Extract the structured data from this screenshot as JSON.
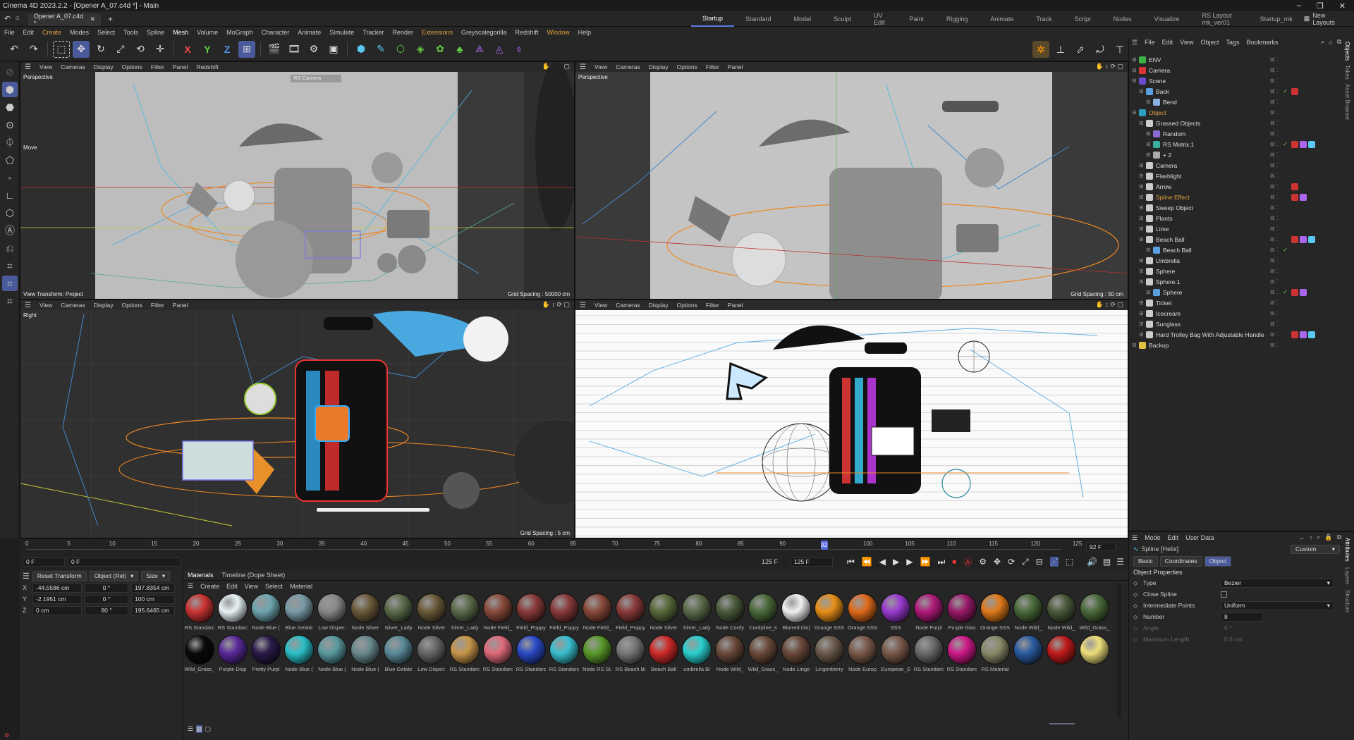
{
  "window": {
    "title": "Cinema 4D 2023.2.2 - [Opener A_07.c4d *] - Main",
    "doc_tab": "Opener A_07.c4d *",
    "new_layouts": "New Layouts"
  },
  "layouts": [
    "Startup",
    "Standard",
    "Model",
    "Sculpt",
    "UV Edit",
    "Paint",
    "Rigging",
    "Animate",
    "Track",
    "Script",
    "Nodes",
    "Visualize",
    "RS Layout mk_ver01",
    "Startup_mk"
  ],
  "menu": [
    "File",
    "Edit",
    "Create",
    "Modes",
    "Select",
    "Tools",
    "Spline",
    "Mesh",
    "Volume",
    "MoGraph",
    "Character",
    "Animate",
    "Simulate",
    "Tracker",
    "Render",
    "Extensions",
    "Greyscalegorilla",
    "Redshift",
    "Window",
    "Help"
  ],
  "viewports": [
    {
      "menu": [
        "View",
        "Cameras",
        "Display",
        "Options",
        "Filter",
        "Panel",
        "Redshift"
      ],
      "name": "Perspective",
      "grid": "Grid Spacing : 50000 cm",
      "transform": "View Transform: Project",
      "camera_tag": "RS Camera",
      "move_label": "Move"
    },
    {
      "menu": [
        "View",
        "Cameras",
        "Display",
        "Options",
        "Filter",
        "Panel"
      ],
      "name": "Perspective",
      "grid": "Grid Spacing : 50 cm"
    },
    {
      "menu": [
        "View",
        "Cameras",
        "Display",
        "Options",
        "Filter",
        "Panel"
      ],
      "name": "Right",
      "grid": "Grid Spacing : 5 cm"
    },
    {
      "menu": [
        "View",
        "Cameras",
        "Display",
        "Options",
        "Filter",
        "Panel"
      ],
      "name": "",
      "grid": ""
    }
  ],
  "timeline": {
    "ticks": [
      "0",
      "5",
      "10",
      "15",
      "20",
      "25",
      "30",
      "35",
      "40",
      "45",
      "50",
      "55",
      "60",
      "65",
      "70",
      "75",
      "80",
      "85",
      "90",
      "95",
      "100",
      "105",
      "110",
      "115",
      "120",
      "125"
    ],
    "current": "92",
    "frame_field": "92 F",
    "start": "0 F",
    "start2": "0 F",
    "end": "125 F",
    "end2": "125 F"
  },
  "coords": {
    "reset": "Reset Transform",
    "mode": "Object (Rel)",
    "size": "Size",
    "rows": [
      {
        "axis": "X",
        "pos": "-44.5586 cm",
        "rot": "0 °",
        "size": "197.8354 cm"
      },
      {
        "axis": "Y",
        "pos": "-2.1951 cm",
        "rot": "0 °",
        "size": "100 cm"
      },
      {
        "axis": "Z",
        "pos": "0 cm",
        "rot": "90 °",
        "size": "195.6465 cm"
      }
    ]
  },
  "materials_tabs": [
    "Materials",
    "Timeline (Dope Sheet)"
  ],
  "materials_menu": [
    "Create",
    "Edit",
    "View",
    "Select",
    "Material"
  ],
  "materials": [
    {
      "label": "RS Standarc",
      "color": "#c33"
    },
    {
      "label": "RS Standarc",
      "color": "#e8f4f6"
    },
    {
      "label": "Node Blue (",
      "color": "#6fa6b0"
    },
    {
      "label": "Blue Gelatir",
      "color": "#7a9aa8"
    },
    {
      "label": "Low Disper:",
      "color": "#888"
    },
    {
      "label": "Node Silver",
      "color": "#6b5a3a"
    },
    {
      "label": "Silver_Lady",
      "color": "#5a6a4a"
    },
    {
      "label": "Node Silver",
      "color": "#6b5a3a"
    },
    {
      "label": "Silver_Lady",
      "color": "#5a6a4a"
    },
    {
      "label": "Node Field_",
      "color": "#8a4a3a"
    },
    {
      "label": "Field_Poppy",
      "color": "#8a3a3a"
    },
    {
      "label": "Field_Poppy",
      "color": "#8a3a3a"
    },
    {
      "label": "Node Field_",
      "color": "#8a4a3a"
    },
    {
      "label": "Field_Poppy",
      "color": "#8a3a3a"
    },
    {
      "label": "Node Silver",
      "color": "#5a6a3a"
    },
    {
      "label": "Silver_Lady",
      "color": "#5a6a4a"
    },
    {
      "label": "Node Cordy",
      "color": "#4a5a3a"
    },
    {
      "label": "Cordyline_s",
      "color": "#4a6a3a"
    },
    {
      "label": "Blurred Dis|",
      "color": "#f0f0f0"
    },
    {
      "label": "Orange SSS",
      "color": "#e8901a"
    },
    {
      "label": "Orange SSS",
      "color": "#e06a1a"
    },
    {
      "label": "SSS",
      "color": "#9a3ad0"
    },
    {
      "label": "Node Purpl",
      "color": "#b01a7a"
    },
    {
      "label": "Purple Glas",
      "color": "#9a1a6a"
    },
    {
      "label": "Orange SSS",
      "color": "#e07a1a"
    },
    {
      "label": "Node Wild_",
      "color": "#4a6a3a"
    },
    {
      "label": "Node Wild_",
      "color": "#4a5a3a"
    },
    {
      "label": "Wild_Grass_",
      "color": "#4a6a3a"
    },
    {
      "label": "Wild_Grass_",
      "color": "#0a0a0a"
    },
    {
      "label": "Purple Disp",
      "color": "#5a2a9a"
    },
    {
      "label": "Pretty Purpl",
      "color": "#2a1a4a"
    },
    {
      "label": "Node Blue (",
      "color": "#2ac0c8"
    },
    {
      "label": "Node Blue (",
      "color": "#5a9aa0"
    },
    {
      "label": "Node Blue (",
      "color": "#6a8a90"
    },
    {
      "label": "Blue Gelatir",
      "color": "#5a8a98"
    },
    {
      "label": "Low Disper:",
      "color": "#666"
    },
    {
      "label": "RS Standarc",
      "color": "#c8964a"
    },
    {
      "label": "RS Standarc",
      "color": "#e06a7a"
    },
    {
      "label": "RS Standarc",
      "color": "#2a4ac8"
    },
    {
      "label": "RS Standarc",
      "color": "#3ac0d0"
    },
    {
      "label": "Node RS St.",
      "color": "#5a9a2a"
    },
    {
      "label": "RS Beach Bi",
      "color": "#777"
    },
    {
      "label": "Beach Ball",
      "color": "#d02a2a"
    },
    {
      "label": "umbrella Bi",
      "color": "#2ad0d0"
    },
    {
      "label": "Node Wild_",
      "color": "#6a4a3a"
    },
    {
      "label": "Wild_Grass_",
      "color": "#6a4a3a"
    },
    {
      "label": "Node Lingo",
      "color": "#6a4a3a"
    },
    {
      "label": "Lingonberry",
      "color": "#6a5a4a"
    },
    {
      "label": "Node Europ",
      "color": "#7a5a4a"
    },
    {
      "label": "European_S",
      "color": "#7a5a4a"
    },
    {
      "label": "RS Standarc",
      "color": "#6a6a6a"
    },
    {
      "label": "RS Standarc",
      "color": "#d01a8a"
    },
    {
      "label": "RS Material",
      "color": "#8a8a6a"
    },
    {
      "label": "",
      "color": "#2a5aa0"
    },
    {
      "label": "",
      "color": "#c01a1a"
    },
    {
      "label": "",
      "color": "#f0e07a"
    }
  ],
  "objects_menu": [
    "File",
    "Edit",
    "View",
    "Object",
    "Tags",
    "Bookmarks"
  ],
  "objects": [
    {
      "name": "ENV",
      "depth": 0,
      "icon": "#3cb043",
      "color": "#ddd"
    },
    {
      "name": "Camera",
      "depth": 0,
      "icon": "#d33",
      "color": "#ddd"
    },
    {
      "name": "Scene",
      "depth": 0,
      "icon": "#6a4ad0",
      "color": "#ddd"
    },
    {
      "name": "Back",
      "depth": 1,
      "icon": "#5aa0e0",
      "color": "#ddd"
    },
    {
      "name": "Bend",
      "depth": 2,
      "icon": "#8ab0e0",
      "color": "#ddd"
    },
    {
      "name": "Object",
      "depth": 0,
      "icon": "#2aa0c0",
      "color": "#e0a040"
    },
    {
      "name": "Grassed Objects",
      "depth": 1,
      "icon": "#ccc",
      "color": "#ddd"
    },
    {
      "name": "Random",
      "depth": 2,
      "icon": "#8a6ad0",
      "color": "#ddd"
    },
    {
      "name": "RS Matrix.1",
      "depth": 2,
      "icon": "#3ab0a0",
      "color": "#ddd"
    },
    {
      "name": "+ 2",
      "depth": 2,
      "icon": "#aaa",
      "color": "#ddd"
    },
    {
      "name": "Camera",
      "depth": 1,
      "icon": "#ccc",
      "color": "#ddd"
    },
    {
      "name": "Flashlight",
      "depth": 1,
      "icon": "#ccc",
      "color": "#ddd"
    },
    {
      "name": "Arrow",
      "depth": 1,
      "icon": "#ccc",
      "color": "#ddd"
    },
    {
      "name": "Spline Effect",
      "depth": 1,
      "icon": "#ccc",
      "color": "#e0a040"
    },
    {
      "name": "Sweep Object",
      "depth": 1,
      "icon": "#ccc",
      "color": "#ddd"
    },
    {
      "name": "Plants",
      "depth": 1,
      "icon": "#ccc",
      "color": "#ddd"
    },
    {
      "name": "Lime",
      "depth": 1,
      "icon": "#ccc",
      "color": "#ddd"
    },
    {
      "name": "Beach Ball",
      "depth": 1,
      "icon": "#ccc",
      "color": "#ddd"
    },
    {
      "name": "Beach Ball",
      "depth": 2,
      "icon": "#5aa0e0",
      "color": "#ddd"
    },
    {
      "name": "Umbrella",
      "depth": 1,
      "icon": "#ccc",
      "color": "#ddd"
    },
    {
      "name": "Sphere",
      "depth": 1,
      "icon": "#ccc",
      "color": "#ddd"
    },
    {
      "name": "Sphere.1",
      "depth": 1,
      "icon": "#ccc",
      "color": "#ddd"
    },
    {
      "name": "Sphere",
      "depth": 2,
      "icon": "#5aa0e0",
      "color": "#ddd"
    },
    {
      "name": "Ticket",
      "depth": 1,
      "icon": "#ccc",
      "color": "#ddd"
    },
    {
      "name": "Icecream",
      "depth": 1,
      "icon": "#ccc",
      "color": "#ddd"
    },
    {
      "name": "Sunglass",
      "depth": 1,
      "icon": "#ccc",
      "color": "#ddd"
    },
    {
      "name": "Hard Trolley Bag With Adjustable Handle",
      "depth": 1,
      "icon": "#ccc",
      "color": "#ddd"
    },
    {
      "name": "Backup",
      "depth": 0,
      "icon": "#e0c040",
      "color": "#ddd"
    }
  ],
  "side_tabs": [
    "Objects",
    "Takes",
    "Asset Browser"
  ],
  "attr_side_tabs": [
    "Attributes",
    "Layers",
    "Structure"
  ],
  "attributes": {
    "menu": [
      "Mode",
      "Edit",
      "User Data"
    ],
    "object": "Spline [Helix]",
    "preset": "Custom",
    "tabs": [
      "Basic",
      "Coordinates",
      "Object"
    ],
    "active_tab": "Object",
    "section": "Object Properties",
    "rows": [
      {
        "label": "Type",
        "value": "Bezier",
        "kind": "select"
      },
      {
        "label": "Close Spline",
        "value": "",
        "kind": "check"
      },
      {
        "label": "Intermediate Points",
        "value": "Uniform",
        "kind": "select"
      },
      {
        "label": "Number",
        "value": "8",
        "kind": "field"
      },
      {
        "label": "Angle",
        "value": "5 °",
        "kind": "dim"
      },
      {
        "label": "Maximum Length",
        "value": "0.5 cm",
        "kind": "dim"
      }
    ]
  }
}
